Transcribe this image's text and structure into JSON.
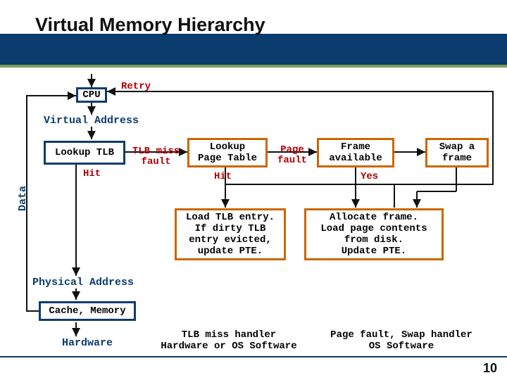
{
  "title": "Virtual Memory Hierarchy",
  "slide_number": "10",
  "retry_label": "Retry",
  "data_label": "Data",
  "boxes": {
    "cpu": "CPU",
    "lookup_tlb": "Lookup TLB",
    "lookup_pt": "Lookup\nPage Table",
    "frame_avail": "Frame\navailable",
    "swap_frame": "Swap a\nframe",
    "load_tlb": "Load TLB entry.\nIf dirty TLB\nentry evicted,\nupdate PTE.",
    "alloc_frame": "Allocate frame.\nLoad page contents\nfrom disk.\nUpdate PTE.",
    "cache_mem": "Cache, Memory"
  },
  "edges": {
    "tlb_miss": "TLB miss\nfault",
    "tlb_hit": "Hit",
    "pt_hit": "Hit",
    "page_fault": "Page\nfault",
    "frame_yes": "Yes"
  },
  "states": {
    "virtual_addr": "Virtual Address",
    "physical_addr": "Physical Address",
    "hardware": "Hardware"
  },
  "footer": {
    "left": "TLB miss handler\nHardware or OS Software",
    "right": "Page fault, Swap handler\nOS Software"
  },
  "chart_data": {
    "type": "diagram",
    "title": "Virtual Memory Hierarchy",
    "nodes": [
      {
        "id": "cpu",
        "label": "CPU",
        "kind": "hw"
      },
      {
        "id": "vaddr",
        "label": "Virtual Address",
        "kind": "state"
      },
      {
        "id": "lookup_tlb",
        "label": "Lookup TLB",
        "kind": "hw"
      },
      {
        "id": "lookup_pt",
        "label": "Lookup Page Table",
        "kind": "sw"
      },
      {
        "id": "frame_avail",
        "label": "Frame available",
        "kind": "sw"
      },
      {
        "id": "swap_frame",
        "label": "Swap a frame",
        "kind": "sw"
      },
      {
        "id": "load_tlb",
        "label": "Load TLB entry. If dirty TLB entry evicted, update PTE.",
        "kind": "sw"
      },
      {
        "id": "alloc_frame",
        "label": "Allocate frame. Load page contents from disk. Update PTE.",
        "kind": "sw"
      },
      {
        "id": "paddr",
        "label": "Physical Address",
        "kind": "state"
      },
      {
        "id": "cache_mem",
        "label": "Cache, Memory",
        "kind": "hw"
      },
      {
        "id": "hardware",
        "label": "Hardware",
        "kind": "state"
      }
    ],
    "edges": [
      {
        "from": "cpu",
        "to": "vaddr"
      },
      {
        "from": "vaddr",
        "to": "lookup_tlb"
      },
      {
        "from": "lookup_tlb",
        "to": "paddr",
        "label": "Hit"
      },
      {
        "from": "lookup_tlb",
        "to": "lookup_pt",
        "label": "TLB miss fault"
      },
      {
        "from": "lookup_pt",
        "to": "load_tlb",
        "label": "Hit"
      },
      {
        "from": "lookup_pt",
        "to": "frame_avail",
        "label": "Page fault"
      },
      {
        "from": "frame_avail",
        "to": "alloc_frame",
        "label": "Yes"
      },
      {
        "from": "frame_avail",
        "to": "swap_frame"
      },
      {
        "from": "swap_frame",
        "to": "alloc_frame"
      },
      {
        "from": "load_tlb",
        "to": "cpu",
        "label": "Retry"
      },
      {
        "from": "alloc_frame",
        "to": "cpu",
        "label": "Retry"
      },
      {
        "from": "paddr",
        "to": "cache_mem"
      },
      {
        "from": "cache_mem",
        "to": "hardware"
      },
      {
        "from": "cache_mem",
        "to": "cpu",
        "label": "Data"
      }
    ],
    "annotations": [
      {
        "region": "lookup_pt,load_tlb",
        "text": "TLB miss handler — Hardware or OS Software"
      },
      {
        "region": "frame_avail,swap_frame,alloc_frame",
        "text": "Page fault, Swap handler — OS Software"
      }
    ]
  }
}
